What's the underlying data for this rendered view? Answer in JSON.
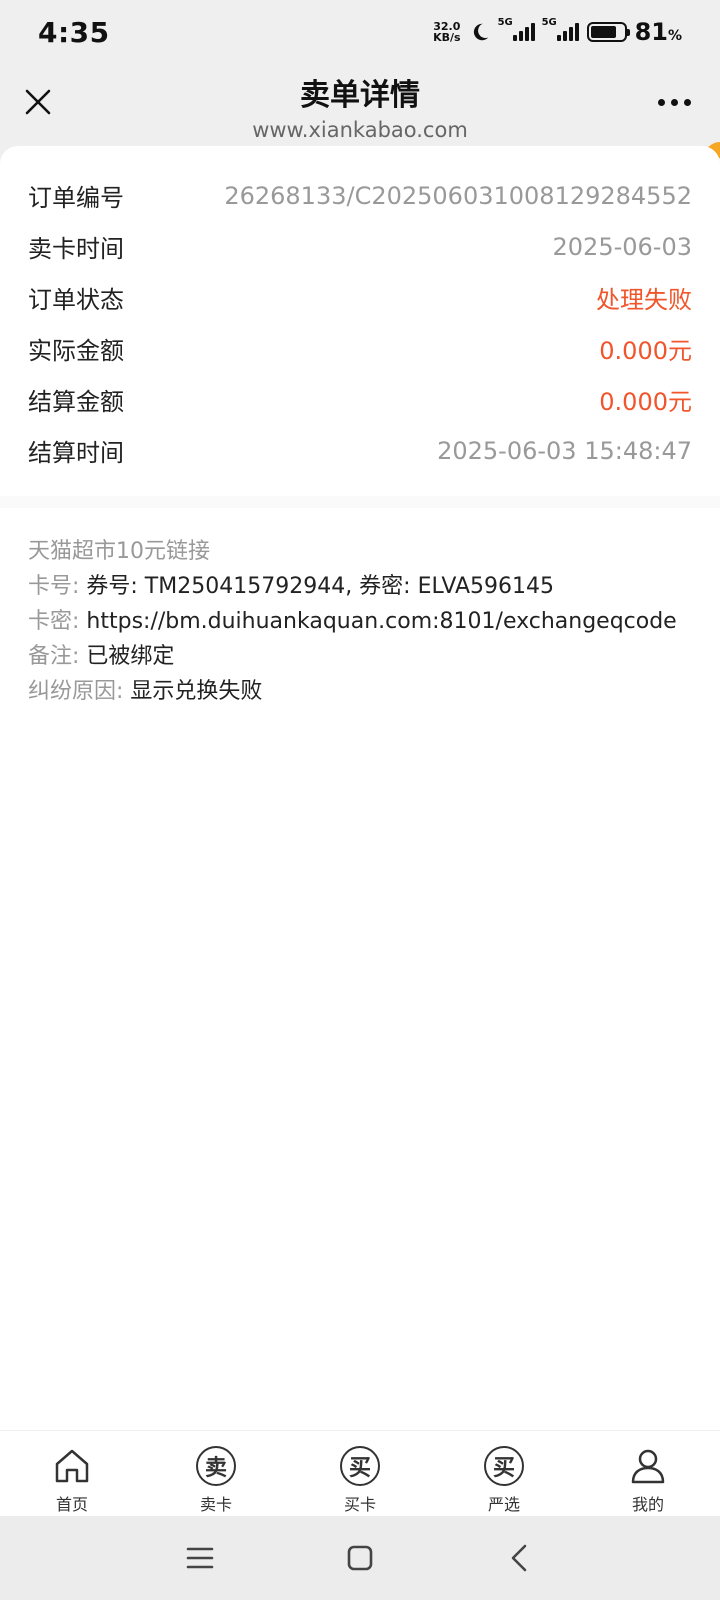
{
  "status": {
    "time": "4:35",
    "net_speed_value": "32.0",
    "net_speed_unit": "KB/s",
    "signal1_label": "5G",
    "signal2_label": "5G",
    "battery_level": "81",
    "battery_unit": "%"
  },
  "header": {
    "title": "卖单详情",
    "subtitle": "www.xiankabao.com"
  },
  "order_info": [
    {
      "label": "订单编号",
      "value": "26268133/C20250603100812928455​2",
      "style": "gray"
    },
    {
      "label": "卖卡时间",
      "value": "2025-06-03",
      "style": "gray"
    },
    {
      "label": "订单状态",
      "value": "处理失败",
      "style": "red"
    },
    {
      "label": "实际金额",
      "value": "0.000元",
      "style": "red"
    },
    {
      "label": "结算金额",
      "value": "0.000元",
      "style": "red"
    },
    {
      "label": "结算时间",
      "value": "2025-06-03 15:48:47",
      "style": "gray"
    }
  ],
  "card_detail": {
    "product_name": "天猫超市10元链接",
    "card_no_label": "卡号: ",
    "card_no_value": "券号: TM250415792944, 券密: ELVA596145",
    "card_secret_label": "卡密: ",
    "card_secret_value": "https://bm.duihuankaquan.com:8101/exchangeqcode",
    "remark_label": "备注: ",
    "remark_value": "已被绑定",
    "dispute_label": "纠纷原因: ",
    "dispute_value": "显示兑换失败"
  },
  "bottom_nav": [
    {
      "label": "首页",
      "icon": "home-icon"
    },
    {
      "label": "卖卡",
      "icon": "sell-icon",
      "glyph": "卖"
    },
    {
      "label": "买卡",
      "icon": "buy-icon",
      "glyph": "买"
    },
    {
      "label": "严选",
      "icon": "select-icon",
      "glyph": "买"
    },
    {
      "label": "我的",
      "icon": "user-icon"
    }
  ],
  "colors": {
    "accent": "#f5a623",
    "error_red": "#f0552b"
  }
}
